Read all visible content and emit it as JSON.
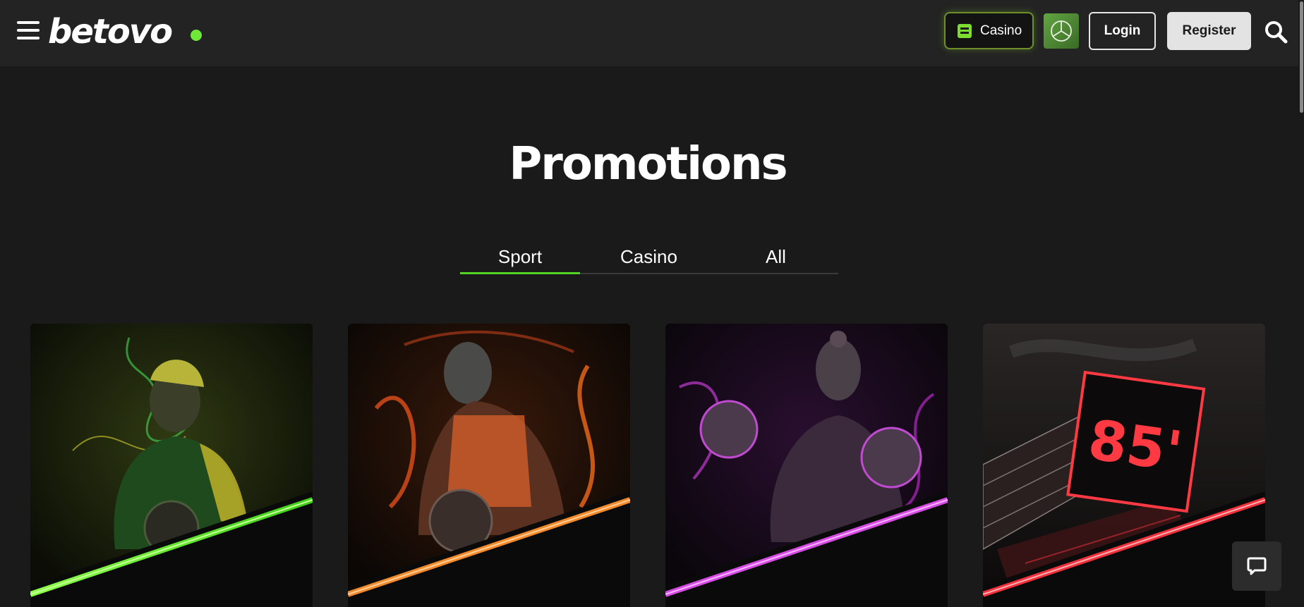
{
  "header": {
    "logo_text": "betovo",
    "casino_label": "Casino",
    "login_label": "Login",
    "register_label": "Register"
  },
  "main": {
    "title": "Promotions",
    "tabs": [
      {
        "label": "Sport",
        "active": true
      },
      {
        "label": "Casino",
        "active": false
      },
      {
        "label": "All",
        "active": false
      }
    ],
    "cards": [
      {
        "name": "football-promo",
        "accent": "#56e02a"
      },
      {
        "name": "basketball-promo",
        "accent": "#f08a2a"
      },
      {
        "name": "boxing-promo",
        "accent": "#d23fe0"
      },
      {
        "name": "85-minute-promo",
        "accent": "#f0303a",
        "billboard_text": "85'"
      }
    ]
  },
  "colors": {
    "background": "#1a1a1a",
    "header": "#232323",
    "accent_green": "#55d323"
  },
  "icons": [
    "menu-icon",
    "slot-machine-icon",
    "mercedes-icon",
    "search-icon",
    "chat-icon"
  ]
}
